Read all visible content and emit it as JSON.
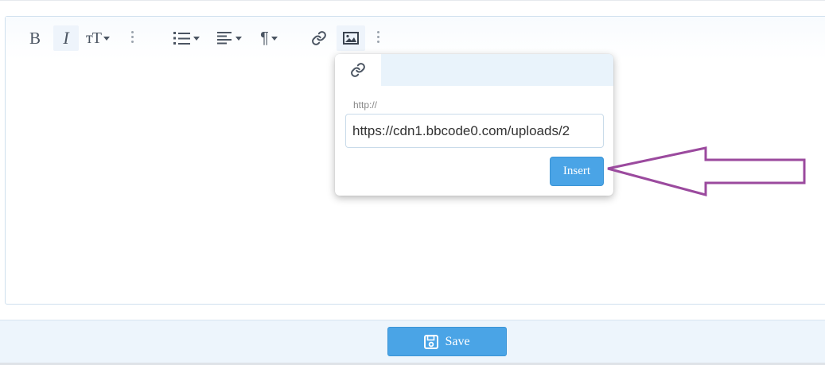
{
  "toolbar": {
    "buttons": [
      {
        "name": "bold",
        "icon": "bold-icon",
        "glyph": "B"
      },
      {
        "name": "italic",
        "icon": "italic-icon",
        "glyph": "I"
      },
      {
        "name": "font-size",
        "icon": "text-size-icon",
        "glyph": "тT"
      },
      {
        "name": "list",
        "icon": "list-icon"
      },
      {
        "name": "align",
        "icon": "align-left-icon"
      },
      {
        "name": "paragraph",
        "icon": "paragraph-icon",
        "glyph": "¶"
      },
      {
        "name": "link",
        "icon": "link-icon"
      },
      {
        "name": "image",
        "icon": "image-icon",
        "active": true
      }
    ]
  },
  "image_popup": {
    "tab_icon": "link-icon",
    "label": "http://",
    "url_value": "https://cdn1.bbcode0.com/uploads/2",
    "insert_label": "Insert"
  },
  "footer": {
    "save_label": "Save",
    "save_icon": "floppy-disk-icon"
  },
  "colors": {
    "accent": "#4aa4e6",
    "annotation_arrow": "#9b4a9e"
  }
}
